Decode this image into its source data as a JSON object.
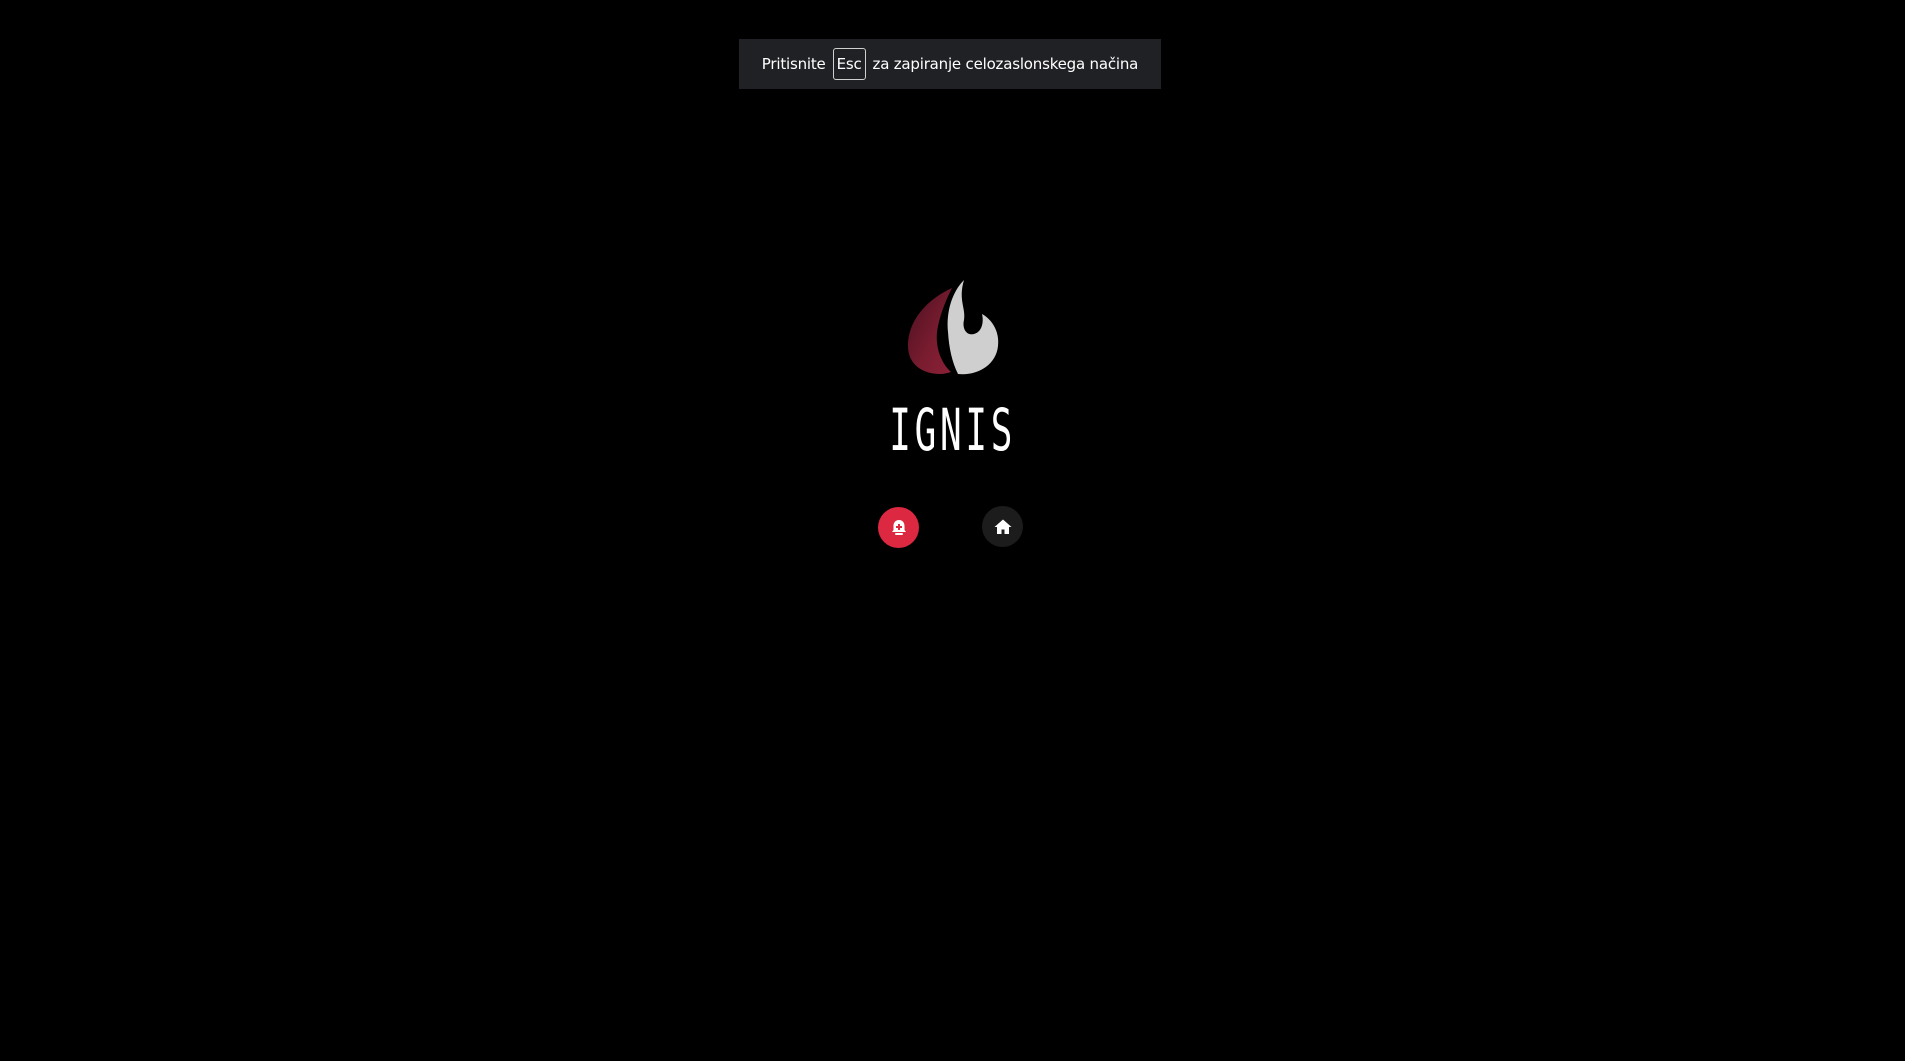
{
  "fullscreen_notice": {
    "prefix": "Pritisnite",
    "key": "Esc",
    "suffix": "za zapiranje celozaslonskega načina"
  },
  "brand": {
    "name": "IGNIS"
  },
  "buttons": {
    "alarm": {
      "icon": "alarm-bell-icon",
      "color": "#dc2840"
    },
    "home": {
      "icon": "home-icon",
      "color": "#1c1c1c"
    }
  },
  "colors": {
    "background": "#000000",
    "notice_background": "#202124",
    "accent": "#dc2840",
    "logo_dark": "#6e1a2c",
    "logo_light": "#cfcfcf"
  }
}
